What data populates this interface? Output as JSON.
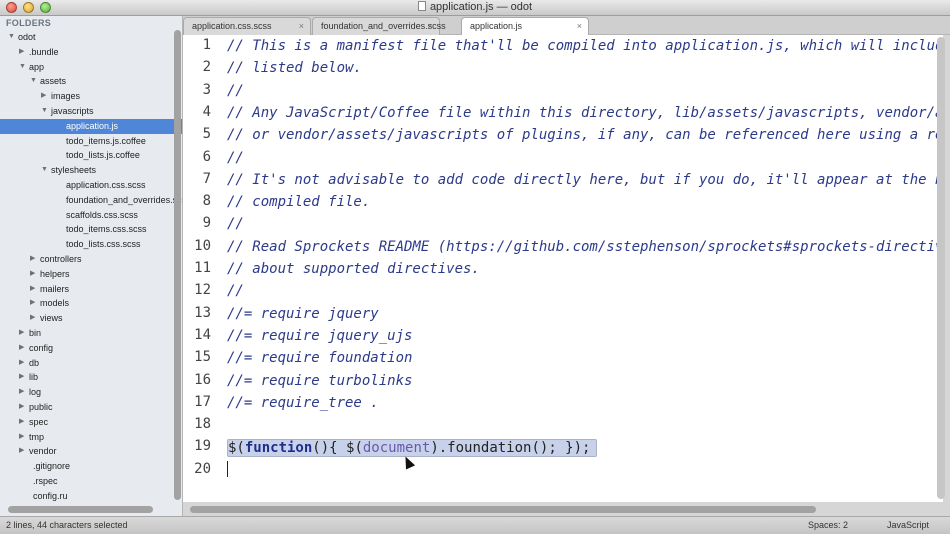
{
  "window": {
    "title": "application.js — odot"
  },
  "sidebar": {
    "header": "FOLDERS",
    "items": [
      {
        "label": "odot",
        "depth": 0,
        "arrow": "▼"
      },
      {
        "label": ".bundle",
        "depth": 1,
        "arrow": "▶"
      },
      {
        "label": "app",
        "depth": 1,
        "arrow": "▼"
      },
      {
        "label": "assets",
        "depth": 2,
        "arrow": "▼"
      },
      {
        "label": "images",
        "depth": 3,
        "arrow": "▶"
      },
      {
        "label": "javascripts",
        "depth": 3,
        "arrow": "▼"
      },
      {
        "label": "application.js",
        "depth": 4,
        "arrow": "",
        "selected": true
      },
      {
        "label": "todo_items.js.coffee",
        "depth": 4,
        "arrow": ""
      },
      {
        "label": "todo_lists.js.coffee",
        "depth": 4,
        "arrow": ""
      },
      {
        "label": "stylesheets",
        "depth": 3,
        "arrow": "▼"
      },
      {
        "label": "application.css.scss",
        "depth": 4,
        "arrow": ""
      },
      {
        "label": "foundation_and_overrides.scss",
        "depth": 4,
        "arrow": ""
      },
      {
        "label": "scaffolds.css.scss",
        "depth": 4,
        "arrow": ""
      },
      {
        "label": "todo_items.css.scss",
        "depth": 4,
        "arrow": ""
      },
      {
        "label": "todo_lists.css.scss",
        "depth": 4,
        "arrow": ""
      },
      {
        "label": "controllers",
        "depth": 2,
        "arrow": "▶"
      },
      {
        "label": "helpers",
        "depth": 2,
        "arrow": "▶"
      },
      {
        "label": "mailers",
        "depth": 2,
        "arrow": "▶"
      },
      {
        "label": "models",
        "depth": 2,
        "arrow": "▶"
      },
      {
        "label": "views",
        "depth": 2,
        "arrow": "▶"
      },
      {
        "label": "bin",
        "depth": 1,
        "arrow": "▶"
      },
      {
        "label": "config",
        "depth": 1,
        "arrow": "▶"
      },
      {
        "label": "db",
        "depth": 1,
        "arrow": "▶"
      },
      {
        "label": "lib",
        "depth": 1,
        "arrow": "▶"
      },
      {
        "label": "log",
        "depth": 1,
        "arrow": "▶"
      },
      {
        "label": "public",
        "depth": 1,
        "arrow": "▶"
      },
      {
        "label": "spec",
        "depth": 1,
        "arrow": "▶"
      },
      {
        "label": "tmp",
        "depth": 1,
        "arrow": "▶"
      },
      {
        "label": "vendor",
        "depth": 1,
        "arrow": "▶"
      },
      {
        "label": ".gitignore",
        "depth": 1,
        "arrow": ""
      },
      {
        "label": ".rspec",
        "depth": 1,
        "arrow": ""
      },
      {
        "label": "config.ru",
        "depth": 1,
        "arrow": ""
      }
    ]
  },
  "tabs": [
    {
      "label": "application.css.scss",
      "active": false
    },
    {
      "label": "foundation_and_overrides.scss",
      "active": false
    },
    {
      "label": "application.js",
      "active": true
    }
  ],
  "tab_close_glyph": "×",
  "editor": {
    "lines": [
      "// This is a manifest file that'll be compiled into application.js, which will include a",
      "// listed below.",
      "//",
      "// Any JavaScript/Coffee file within this directory, lib/assets/javascripts, vendor/asse",
      "// or vendor/assets/javascripts of plugins, if any, can be referenced here using a relati",
      "//",
      "// It's not advisable to add code directly here, but if you do, it'll appear at the botto",
      "// compiled file.",
      "//",
      "// Read Sprockets README (https://github.com/sstephenson/sprockets#sprockets-directives)",
      "// about supported directives.",
      "//",
      "//= require jquery",
      "//= require jquery_ujs",
      "//= require foundation",
      "//= require turbolinks",
      "//= require_tree .",
      "",
      "",
      ""
    ],
    "line19": {
      "p1": "$(",
      "kw": "function",
      "p2": "(){ $(",
      "fn": "document",
      "p3": ").foundation(); });"
    }
  },
  "statusbar": {
    "selection": "2 lines, 44 characters selected",
    "spaces": "Spaces: 2",
    "syntax": "JavaScript"
  },
  "colors": {
    "selection_row": "#4f86d8",
    "comment": "#2c3a8a",
    "selection_highlight": "#c7d2ea"
  }
}
